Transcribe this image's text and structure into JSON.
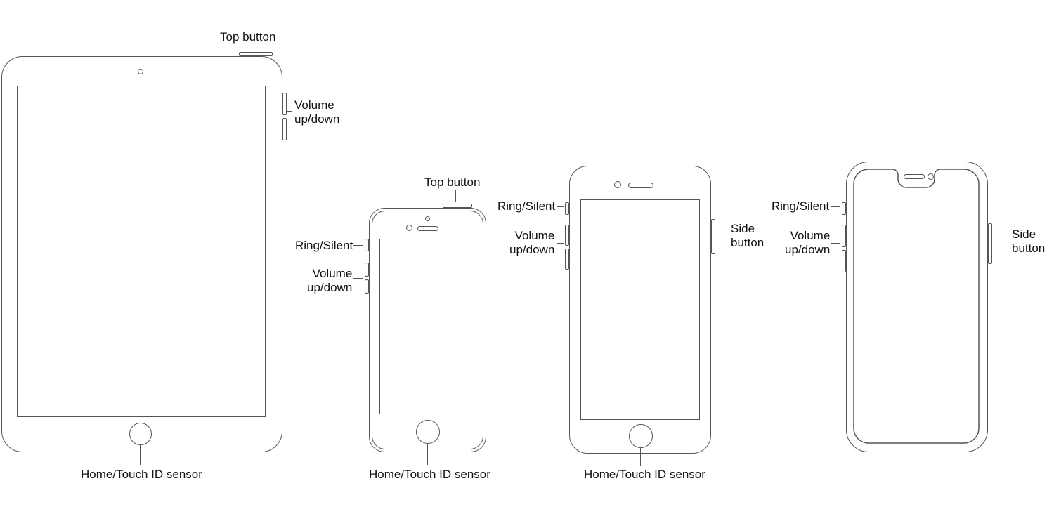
{
  "colors": {
    "line": "#555555",
    "text": "#111111",
    "bg": "#ffffff"
  },
  "devices": [
    {
      "id": "ipad",
      "labels": {
        "top_button": "Top button",
        "volume": "Volume\nup/down",
        "home": "Home/Touch ID sensor"
      }
    },
    {
      "id": "iphone-se",
      "labels": {
        "top_button": "Top button",
        "ring_silent": "Ring/Silent",
        "volume": "Volume\nup/down",
        "home": "Home/Touch ID sensor"
      }
    },
    {
      "id": "iphone-home",
      "labels": {
        "ring_silent": "Ring/Silent",
        "volume": "Volume\nup/down",
        "side_button": "Side\nbutton",
        "home": "Home/Touch ID sensor"
      }
    },
    {
      "id": "iphone-faceid",
      "labels": {
        "ring_silent": "Ring/Silent",
        "volume": "Volume\nup/down",
        "side_button": "Side\nbutton"
      }
    }
  ]
}
